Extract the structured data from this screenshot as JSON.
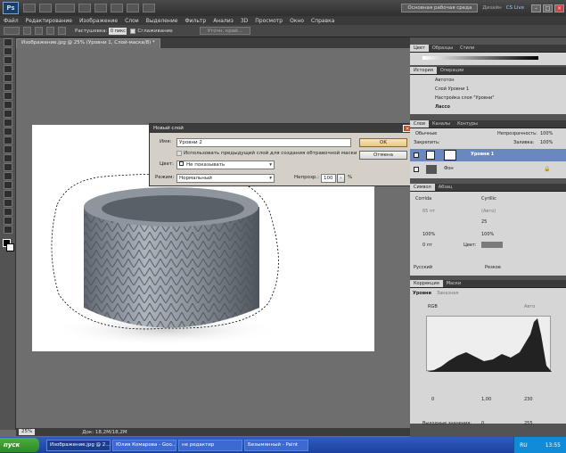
{
  "app": {
    "logo": "Ps",
    "workspace": "Основная рабочая среда",
    "design": "Дизайн",
    "cs_live": "CS Live"
  },
  "menu": [
    "Файл",
    "Редактирование",
    "Изображение",
    "Слои",
    "Выделение",
    "Фильтр",
    "Анализ",
    "3D",
    "Просмотр",
    "Окно",
    "Справка"
  ],
  "options": {
    "feather_label": "Растушевка:",
    "feather_value": "0 пикс",
    "antialias": "Сглаживание",
    "refine": "Уточн. край..."
  },
  "document": {
    "tab": "Изображение.jpg @ 25% (Уровни 1, Слой-маска/8) *",
    "zoom": "25%",
    "doc_info": "Док: 18,2M/18,2M"
  },
  "dialog": {
    "title": "Новый слой",
    "name_label": "Имя:",
    "name_value": "Уровни 2",
    "clip_label": "Использовать предыдущий слой для создания обтравочной маски",
    "color_label": "Цвет:",
    "color_value": "Не показывать",
    "mode_label": "Режим:",
    "mode_value": "Нормальный",
    "opacity_label": "Непрозр.:",
    "opacity_value": "100",
    "opacity_unit": "%",
    "ok": "OK",
    "cancel": "Отмена"
  },
  "panels": {
    "color_tabs": [
      "Цвет",
      "Образцы",
      "Стили"
    ],
    "history_tabs": [
      "История",
      "Операции"
    ],
    "history_items": [
      "Автотон",
      "Слой Уровни 1",
      "Настройка слоя \"Уровни\"",
      "Лассо"
    ],
    "layers_tabs": [
      "Слои",
      "Каналы",
      "Контуры"
    ],
    "layers_mode": "Обычные",
    "layers_opacity_label": "Непрозрачность:",
    "layers_opacity_value": "100%",
    "layers_lock_label": "Закрепить:",
    "layers_fill_label": "Заливка:",
    "layers_fill_value": "100%",
    "layers": [
      {
        "name": "Уровни 1"
      },
      {
        "name": "Фон"
      }
    ],
    "char_tabs": [
      "Символ",
      "Абзац"
    ],
    "char_font": "Corrida",
    "char_style": "Cyrillic",
    "char_size": "65 пт",
    "char_leading": "(Авто)",
    "char_tracking": "25",
    "char_vscale": "100%",
    "char_hscale": "100%",
    "char_baseline": "0 пт",
    "char_color_label": "Цвет:",
    "char_lang": "Русский",
    "char_aa": "Резкое",
    "adj_tabs": [
      "Коррекция",
      "Маски"
    ],
    "adj_title": "Уровни",
    "adj_preset": "Заказная",
    "adj_channel": "RGB",
    "adj_auto": "Авто",
    "input_values": [
      "0",
      "1,00",
      "230"
    ],
    "output_label": "Выходные значения:",
    "output_values": [
      "0",
      "255"
    ]
  },
  "taskbar": {
    "start": "пуск",
    "tasks": [
      "Изображение.jpg @ 2...",
      "Юлия Комарова - Goo...",
      "не редактир",
      "Безымянный - Paint"
    ],
    "lang": "RU",
    "time": "13:55"
  },
  "colors": {
    "accent": "#1f5fb9",
    "dialog_bg": "#d4d0c8",
    "ok_button": "#e8c882",
    "panel_bg": "#d6d6d6"
  }
}
